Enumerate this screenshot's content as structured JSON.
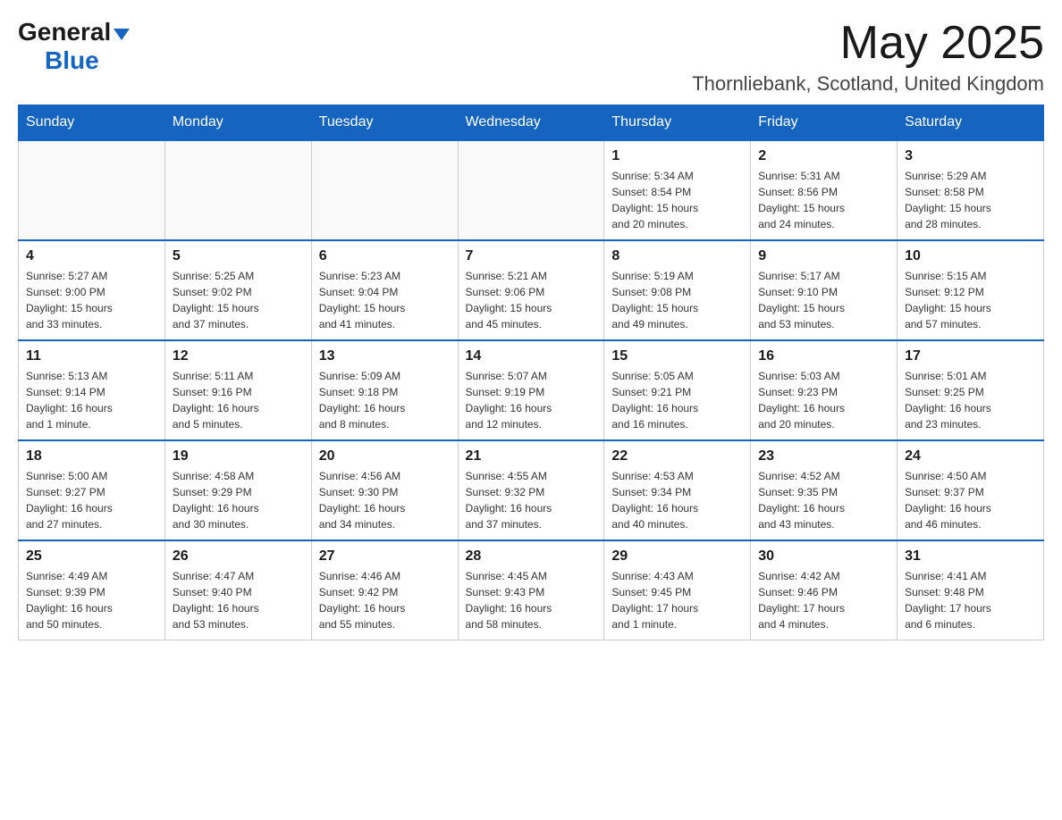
{
  "header": {
    "logo_general": "General",
    "logo_blue": "Blue",
    "month_title": "May 2025",
    "location": "Thornliebank, Scotland, United Kingdom"
  },
  "days_of_week": [
    "Sunday",
    "Monday",
    "Tuesday",
    "Wednesday",
    "Thursday",
    "Friday",
    "Saturday"
  ],
  "weeks": [
    [
      {
        "day": "",
        "info": ""
      },
      {
        "day": "",
        "info": ""
      },
      {
        "day": "",
        "info": ""
      },
      {
        "day": "",
        "info": ""
      },
      {
        "day": "1",
        "info": "Sunrise: 5:34 AM\nSunset: 8:54 PM\nDaylight: 15 hours\nand 20 minutes."
      },
      {
        "day": "2",
        "info": "Sunrise: 5:31 AM\nSunset: 8:56 PM\nDaylight: 15 hours\nand 24 minutes."
      },
      {
        "day": "3",
        "info": "Sunrise: 5:29 AM\nSunset: 8:58 PM\nDaylight: 15 hours\nand 28 minutes."
      }
    ],
    [
      {
        "day": "4",
        "info": "Sunrise: 5:27 AM\nSunset: 9:00 PM\nDaylight: 15 hours\nand 33 minutes."
      },
      {
        "day": "5",
        "info": "Sunrise: 5:25 AM\nSunset: 9:02 PM\nDaylight: 15 hours\nand 37 minutes."
      },
      {
        "day": "6",
        "info": "Sunrise: 5:23 AM\nSunset: 9:04 PM\nDaylight: 15 hours\nand 41 minutes."
      },
      {
        "day": "7",
        "info": "Sunrise: 5:21 AM\nSunset: 9:06 PM\nDaylight: 15 hours\nand 45 minutes."
      },
      {
        "day": "8",
        "info": "Sunrise: 5:19 AM\nSunset: 9:08 PM\nDaylight: 15 hours\nand 49 minutes."
      },
      {
        "day": "9",
        "info": "Sunrise: 5:17 AM\nSunset: 9:10 PM\nDaylight: 15 hours\nand 53 minutes."
      },
      {
        "day": "10",
        "info": "Sunrise: 5:15 AM\nSunset: 9:12 PM\nDaylight: 15 hours\nand 57 minutes."
      }
    ],
    [
      {
        "day": "11",
        "info": "Sunrise: 5:13 AM\nSunset: 9:14 PM\nDaylight: 16 hours\nand 1 minute."
      },
      {
        "day": "12",
        "info": "Sunrise: 5:11 AM\nSunset: 9:16 PM\nDaylight: 16 hours\nand 5 minutes."
      },
      {
        "day": "13",
        "info": "Sunrise: 5:09 AM\nSunset: 9:18 PM\nDaylight: 16 hours\nand 8 minutes."
      },
      {
        "day": "14",
        "info": "Sunrise: 5:07 AM\nSunset: 9:19 PM\nDaylight: 16 hours\nand 12 minutes."
      },
      {
        "day": "15",
        "info": "Sunrise: 5:05 AM\nSunset: 9:21 PM\nDaylight: 16 hours\nand 16 minutes."
      },
      {
        "day": "16",
        "info": "Sunrise: 5:03 AM\nSunset: 9:23 PM\nDaylight: 16 hours\nand 20 minutes."
      },
      {
        "day": "17",
        "info": "Sunrise: 5:01 AM\nSunset: 9:25 PM\nDaylight: 16 hours\nand 23 minutes."
      }
    ],
    [
      {
        "day": "18",
        "info": "Sunrise: 5:00 AM\nSunset: 9:27 PM\nDaylight: 16 hours\nand 27 minutes."
      },
      {
        "day": "19",
        "info": "Sunrise: 4:58 AM\nSunset: 9:29 PM\nDaylight: 16 hours\nand 30 minutes."
      },
      {
        "day": "20",
        "info": "Sunrise: 4:56 AM\nSunset: 9:30 PM\nDaylight: 16 hours\nand 34 minutes."
      },
      {
        "day": "21",
        "info": "Sunrise: 4:55 AM\nSunset: 9:32 PM\nDaylight: 16 hours\nand 37 minutes."
      },
      {
        "day": "22",
        "info": "Sunrise: 4:53 AM\nSunset: 9:34 PM\nDaylight: 16 hours\nand 40 minutes."
      },
      {
        "day": "23",
        "info": "Sunrise: 4:52 AM\nSunset: 9:35 PM\nDaylight: 16 hours\nand 43 minutes."
      },
      {
        "day": "24",
        "info": "Sunrise: 4:50 AM\nSunset: 9:37 PM\nDaylight: 16 hours\nand 46 minutes."
      }
    ],
    [
      {
        "day": "25",
        "info": "Sunrise: 4:49 AM\nSunset: 9:39 PM\nDaylight: 16 hours\nand 50 minutes."
      },
      {
        "day": "26",
        "info": "Sunrise: 4:47 AM\nSunset: 9:40 PM\nDaylight: 16 hours\nand 53 minutes."
      },
      {
        "day": "27",
        "info": "Sunrise: 4:46 AM\nSunset: 9:42 PM\nDaylight: 16 hours\nand 55 minutes."
      },
      {
        "day": "28",
        "info": "Sunrise: 4:45 AM\nSunset: 9:43 PM\nDaylight: 16 hours\nand 58 minutes."
      },
      {
        "day": "29",
        "info": "Sunrise: 4:43 AM\nSunset: 9:45 PM\nDaylight: 17 hours\nand 1 minute."
      },
      {
        "day": "30",
        "info": "Sunrise: 4:42 AM\nSunset: 9:46 PM\nDaylight: 17 hours\nand 4 minutes."
      },
      {
        "day": "31",
        "info": "Sunrise: 4:41 AM\nSunset: 9:48 PM\nDaylight: 17 hours\nand 6 minutes."
      }
    ]
  ]
}
